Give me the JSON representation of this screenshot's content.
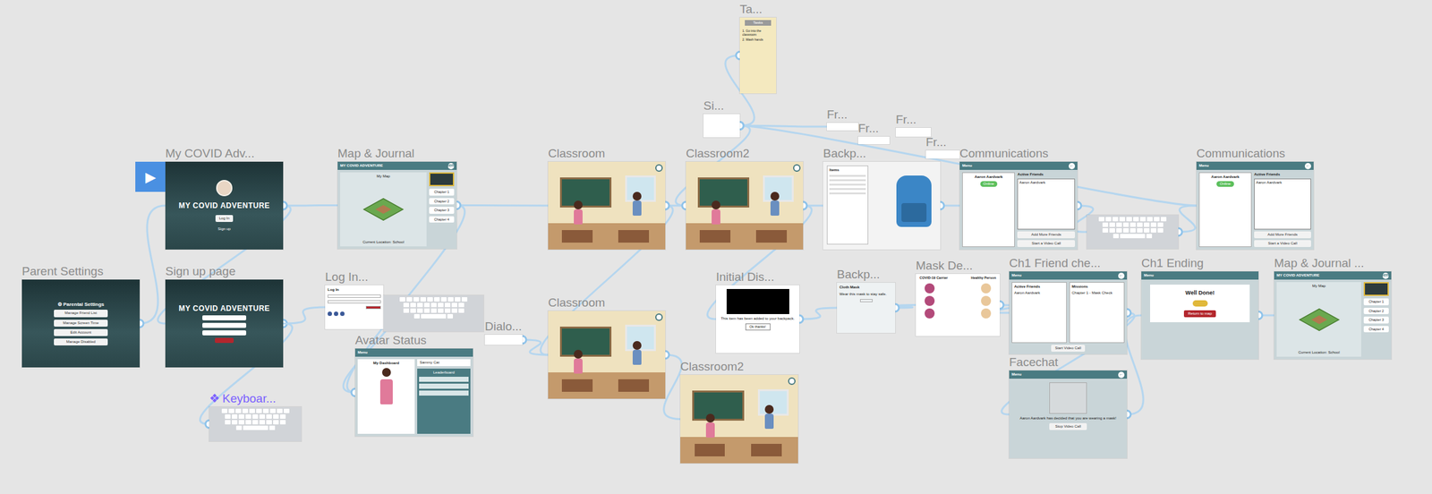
{
  "prototype_play": "▶",
  "frames": [
    {
      "label": "Ta...",
      "kind": "note",
      "component": false,
      "texts": [
        "Tasks",
        "1. Go into the classroom",
        "2. Wash hands"
      ]
    },
    {
      "label": "Si...",
      "kind": "blank",
      "component": false,
      "texts": []
    },
    {
      "label": "My COVID Adv...",
      "kind": "title",
      "component": false,
      "texts": [
        "MY COVID ADVENTURE",
        "Log In",
        "Sign up"
      ]
    },
    {
      "label": "Map & Journal",
      "kind": "map",
      "component": false,
      "texts": [
        "MY COVID ADVENTURE",
        "Menu",
        "My Map",
        "Current Location: School",
        "Chapter 1",
        "Chapter 2",
        "Chapter 3",
        "Chapter 4"
      ]
    },
    {
      "label": "Classroom",
      "kind": "classroom",
      "component": false,
      "texts": []
    },
    {
      "label": "Classroom2",
      "kind": "classroom",
      "component": false,
      "texts": []
    },
    {
      "label": "Backp...",
      "kind": "backpack",
      "component": false,
      "texts": [
        "Items"
      ]
    },
    {
      "label": "Communications",
      "kind": "chat",
      "component": false,
      "texts": [
        "Menu",
        "←",
        "Aaron Aardvark",
        "Online",
        "Active Friends",
        "Aaron Aardvark",
        "Add More Friends",
        "Start a Video Call"
      ]
    },
    {
      "kind": "keyboard",
      "component": false,
      "texts": []
    },
    {
      "label": "Communications",
      "kind": "chat",
      "component": false,
      "texts": [
        "Menu",
        "←",
        "Aaron Aardvark",
        "Online",
        "Active Friends",
        "Aaron Aardvark",
        "Add More Friends",
        "Start a Video Call"
      ]
    },
    {
      "label": "Parent Settings",
      "kind": "settings",
      "component": false,
      "texts": [
        "⚙ Parental Settings",
        "Manage Friend List",
        "Manage Screen Time",
        "Edit Account",
        "Manage Disabled"
      ]
    },
    {
      "label": "Sign up page",
      "kind": "signup",
      "component": false,
      "texts": [
        "MY COVID ADVENTURE"
      ]
    },
    {
      "label": "Log In...",
      "kind": "login",
      "component": false,
      "texts": [
        "Log In"
      ]
    },
    {
      "kind": "keyboard",
      "component": false,
      "texts": []
    },
    {
      "label": "Avatar Status",
      "kind": "avatar",
      "component": false,
      "texts": [
        "Menu",
        "My Dashboard",
        "Sammy Cat",
        "Leaderboard"
      ]
    },
    {
      "label": "Dialo...",
      "kind": "blank",
      "component": false,
      "texts": []
    },
    {
      "label": "Classroom",
      "kind": "classroom",
      "component": false,
      "texts": []
    },
    {
      "label": "Classroom2",
      "kind": "classroom",
      "component": false,
      "texts": []
    },
    {
      "label": "Initial Dis...",
      "kind": "dialog",
      "component": false,
      "texts": [
        "This item has been added to your backpack.",
        "Ok thanks!"
      ]
    },
    {
      "label": "Backp...",
      "kind": "info",
      "component": false,
      "texts": [
        "Cloth Mask",
        "Wear this mask to stay safe."
      ]
    },
    {
      "label": "Mask De...",
      "kind": "mask",
      "component": false,
      "texts": [
        "COVID-19 Carrier",
        "Healthy Person"
      ]
    },
    {
      "label": "Ch1 Friend che...",
      "kind": "friendcheck",
      "component": false,
      "texts": [
        "Menu",
        "←",
        "Active Friends",
        "Missions",
        "Aaron Aardvark",
        "Chapter 1 - Mask Check",
        "Start Video Call"
      ]
    },
    {
      "label": "Facechat",
      "kind": "facechat",
      "component": false,
      "texts": [
        "Menu",
        "←",
        "Aaron Aardvark has decided that you are wearing a mask!",
        "Stop Video Call"
      ]
    },
    {
      "label": "Ch1 Ending",
      "kind": "ending",
      "component": false,
      "texts": [
        "Menu",
        "Well Done!",
        "Return to map"
      ]
    },
    {
      "label": "Map & Journal ...",
      "kind": "map",
      "component": false,
      "texts": [
        "MY COVID ADVENTURE",
        "Menu",
        "My Map",
        "Current Location: School",
        "Chapter 1",
        "Chapter 2",
        "Chapter 3",
        "Chapter 4"
      ]
    },
    {
      "label": "Keyboar...",
      "label_icon": "❖",
      "kind": "keyboard",
      "component": true,
      "texts": []
    },
    {
      "label": "Fr...",
      "kind": "blank",
      "component": false,
      "texts": []
    },
    {
      "label": "Fr...",
      "kind": "blank",
      "component": false,
      "texts": []
    },
    {
      "label": "Fr...",
      "kind": "blank",
      "component": false,
      "texts": []
    },
    {
      "label": "Fr...",
      "kind": "blank",
      "component": false,
      "texts": []
    }
  ],
  "connections": [
    {
      "from": 2,
      "to": 3
    },
    {
      "from": 2,
      "to": 11
    },
    {
      "from": 11,
      "to": 12
    },
    {
      "from": 10,
      "to": 2
    },
    {
      "from": 25,
      "to": 11
    },
    {
      "from": 12,
      "to": 14
    },
    {
      "from": 14,
      "to": 3
    },
    {
      "from": 3,
      "to": 4
    },
    {
      "from": 4,
      "to": 5
    },
    {
      "from": 5,
      "to": 6
    },
    {
      "from": 6,
      "to": 7
    },
    {
      "from": 7,
      "to": 8
    },
    {
      "from": 8,
      "to": 9
    },
    {
      "from": 5,
      "to": 18
    },
    {
      "from": 18,
      "to": 19
    },
    {
      "from": 19,
      "to": 20
    },
    {
      "from": 20,
      "to": 21
    },
    {
      "from": 21,
      "to": 22
    },
    {
      "from": 22,
      "to": 23
    },
    {
      "from": 23,
      "to": 24
    },
    {
      "from": 16,
      "to": 17
    },
    {
      "from": 4,
      "to": 16
    },
    {
      "from": 5,
      "to": 1
    },
    {
      "from": 0,
      "to": 1
    },
    {
      "from": 1,
      "to": 26
    },
    {
      "from": 1,
      "to": 9
    },
    {
      "from": 15,
      "to": 16
    },
    {
      "from": 13,
      "to": 12
    }
  ]
}
